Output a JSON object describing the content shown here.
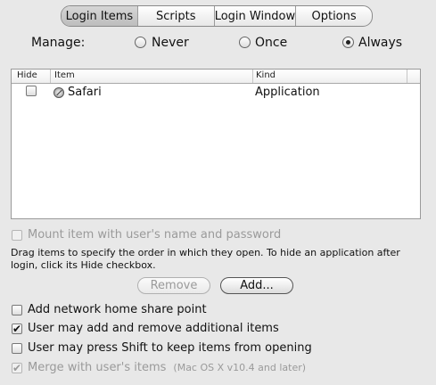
{
  "tabs": [
    {
      "label": "Login Items",
      "active": true
    },
    {
      "label": "Scripts",
      "active": false
    },
    {
      "label": "Login Window",
      "active": false
    },
    {
      "label": "Options",
      "active": false
    }
  ],
  "manage": {
    "label": "Manage:",
    "options": [
      {
        "label": "Never",
        "selected": false
      },
      {
        "label": "Once",
        "selected": false
      },
      {
        "label": "Always",
        "selected": true
      }
    ]
  },
  "table": {
    "columns": [
      "Hide",
      "Item",
      "Kind"
    ],
    "rows": [
      {
        "hide": false,
        "item": "Safari",
        "kind": "Application",
        "icon": "safari-icon"
      }
    ]
  },
  "mount": {
    "label": "Mount item with user's name and password",
    "checked": false,
    "enabled": false
  },
  "help_text": "Drag items to specify the order in which they open. To hide an application after login, click its Hide checkbox.",
  "buttons": {
    "remove": "Remove",
    "add": "Add..."
  },
  "options": [
    {
      "label": "Add network home share point",
      "checked": false,
      "enabled": true
    },
    {
      "label": "User may add and remove additional items",
      "checked": true,
      "enabled": true
    },
    {
      "label": "User may press Shift to keep items from opening",
      "checked": false,
      "enabled": true
    }
  ],
  "merge": {
    "label": "Merge with user's items",
    "note": "(Mac OS X v10.4 and later)",
    "checked": true,
    "enabled": false
  }
}
